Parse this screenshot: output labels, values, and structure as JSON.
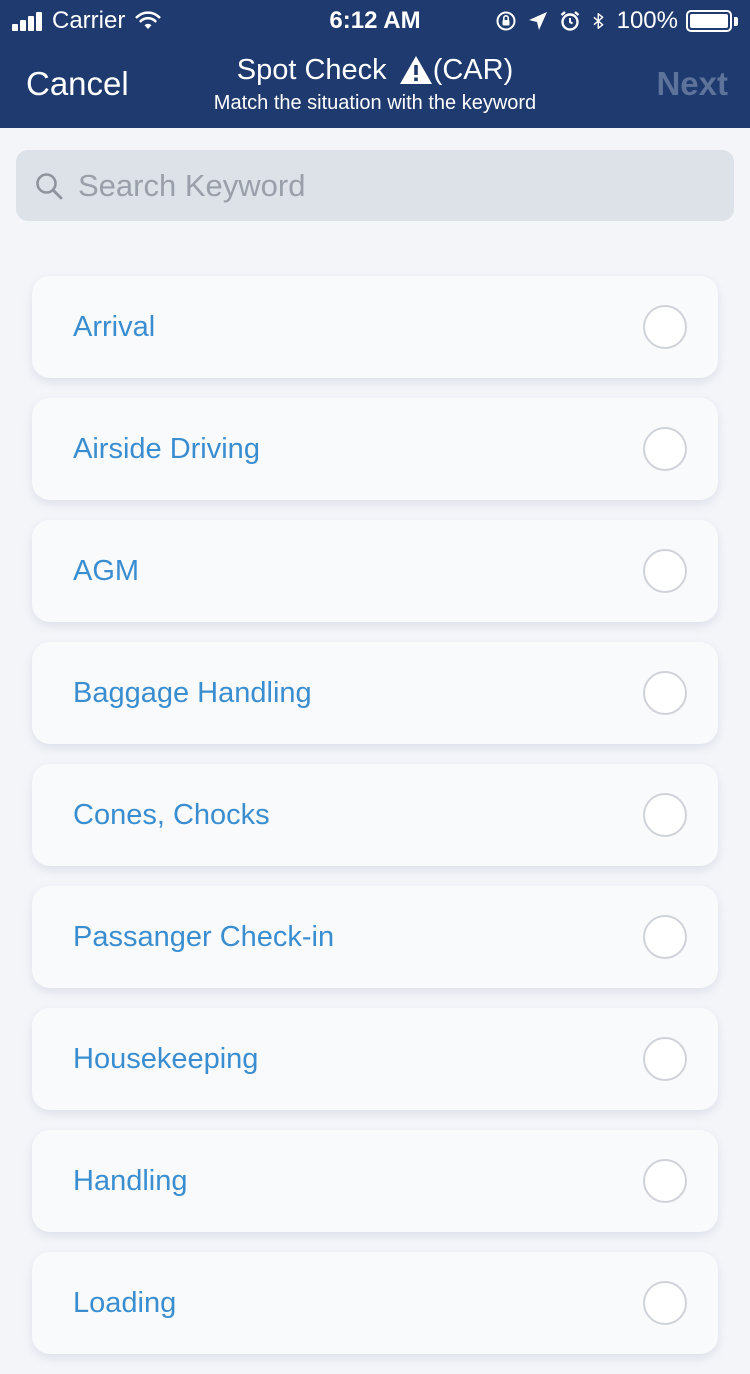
{
  "status_bar": {
    "carrier": "Carrier",
    "time": "6:12 AM",
    "battery": "100%"
  },
  "nav": {
    "cancel_label": "Cancel",
    "title": "Spot Check",
    "title_suffix": "(CAR)",
    "subtitle": "Match the situation with the keyword",
    "next_label": "Next"
  },
  "search": {
    "placeholder": "Search Keyword",
    "value": ""
  },
  "keywords": [
    {
      "label": "Arrival",
      "selected": false
    },
    {
      "label": "Airside Driving",
      "selected": false
    },
    {
      "label": "AGM",
      "selected": false
    },
    {
      "label": "Baggage Handling",
      "selected": false
    },
    {
      "label": "Cones, Chocks",
      "selected": false
    },
    {
      "label": "Passanger Check-in",
      "selected": false
    },
    {
      "label": "Housekeeping",
      "selected": false
    },
    {
      "label": "Handling",
      "selected": false
    },
    {
      "label": "Loading",
      "selected": false
    }
  ],
  "colors": {
    "header_bg": "#1e3a6e",
    "accent_text": "#3a8ed0",
    "disabled_next": "#5d739a",
    "page_bg": "#f3f5f9"
  },
  "icons": {
    "signal": "cellular-signal-icon",
    "wifi": "wifi-icon",
    "orientation_lock": "orientation-lock-icon",
    "location": "location-arrow-icon",
    "alarm": "alarm-icon",
    "bluetooth": "bluetooth-icon",
    "battery": "battery-icon",
    "warning": "warning-triangle-icon",
    "search": "search-icon",
    "radio": "radio-circle-icon"
  }
}
